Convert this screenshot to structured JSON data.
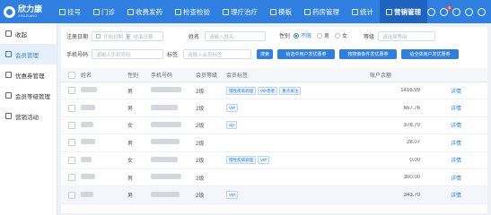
{
  "brand": {
    "name": "欣力康",
    "sub": "XINLIKANG"
  },
  "nav": [
    {
      "label": "挂号",
      "icon": "register-icon"
    },
    {
      "label": "门诊",
      "icon": "clinic-icon"
    },
    {
      "label": "收费发药",
      "icon": "cashier-icon"
    },
    {
      "label": "检查检验",
      "icon": "lab-icon"
    },
    {
      "label": "理疗治疗",
      "icon": "therapy-icon"
    },
    {
      "label": "模板",
      "icon": "template-icon"
    },
    {
      "label": "药房管理",
      "icon": "pharmacy-icon"
    },
    {
      "label": "统计",
      "icon": "stats-icon"
    },
    {
      "label": "营销管理",
      "icon": "marketing-icon",
      "active": true
    }
  ],
  "tools": {
    "notify_count": "6"
  },
  "sidebar": [
    {
      "label": "收起",
      "icon": "collapse-icon"
    },
    {
      "label": "会员管理",
      "icon": "member-icon",
      "active": true
    },
    {
      "label": "优惠券管理",
      "icon": "coupon-icon"
    },
    {
      "label": "会员等级管理",
      "icon": "level-icon"
    },
    {
      "label": "营销活动",
      "icon": "campaign-icon"
    }
  ],
  "filters": {
    "reg_date_label": "注册日期",
    "start_placeholder": "开始日期",
    "range_sep": "至",
    "end_placeholder": "结束日期",
    "name_label": "姓名",
    "name_placeholder": "请输入姓名",
    "gender_label": "性别",
    "gender_options": [
      "不限",
      "男",
      "女"
    ],
    "level_label": "等级",
    "level_placeholder": "请选择等级",
    "phone_label": "手机号码",
    "phone_placeholder": "请输入手机号码",
    "tag_label": "标签",
    "tag_placeholder": "请输入会员标签",
    "search_btn": "搜索",
    "btn_coupon_user": "给选中用户发优惠券",
    "btn_coupon_cond": "按搜索条件发优惠券",
    "btn_coupon_all": "给全体用户发优惠券"
  },
  "table": {
    "headers": [
      "姓名",
      "性别",
      "手机号码",
      "会员等级",
      "会员标签",
      "账户余额",
      ""
    ],
    "rows": [
      {
        "gender": "男",
        "level": "2级",
        "tags": [
          "慢性疾病调理",
          "VIP患者",
          "重点关注"
        ],
        "balance": "1416.99",
        "action": "详情"
      },
      {
        "gender": "男",
        "level": "2级",
        "tags": [
          "VIP"
        ],
        "balance": "657.76",
        "action": "详情"
      },
      {
        "gender": "女",
        "level": "2级",
        "tags": [
          "vip"
        ],
        "balance": "378.70",
        "action": "详情"
      },
      {
        "gender": "男",
        "level": "2级",
        "tags": [],
        "balance": "28.07",
        "action": "详情"
      },
      {
        "gender": "女",
        "level": "2级",
        "tags": [
          "慢性疾病调理",
          "VIP"
        ],
        "balance": "0.00",
        "action": "详情"
      },
      {
        "gender": "男",
        "level": "2级",
        "tags": [],
        "balance": "300.00",
        "action": "详情"
      },
      {
        "gender": "男",
        "level": "2级",
        "tags": [
          "VIP"
        ],
        "balance": "343.70",
        "action": "详情"
      }
    ]
  }
}
